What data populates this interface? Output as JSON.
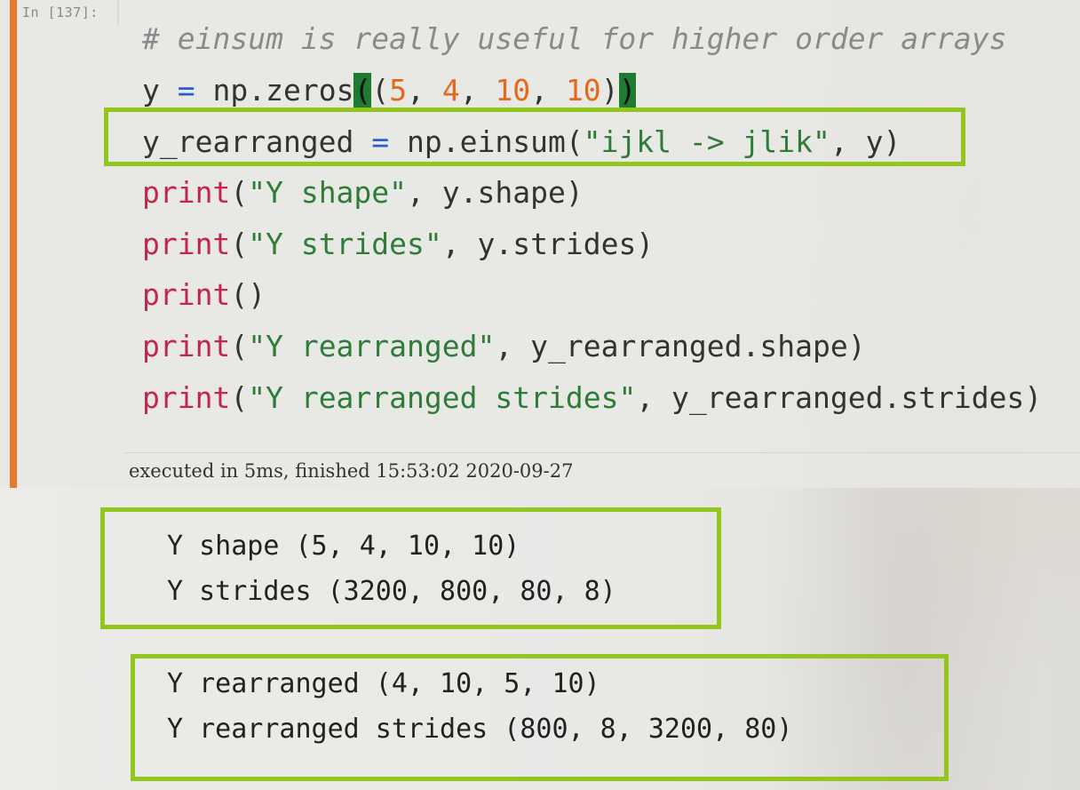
{
  "cell": {
    "prompt": "In [137]:",
    "code_lines": [
      {
        "segments": [
          {
            "cls": "cm",
            "text": "# einsum is really useful for higher order arrays"
          }
        ]
      },
      {
        "segments": [
          {
            "cls": "",
            "text": "y "
          },
          {
            "cls": "op",
            "text": "="
          },
          {
            "cls": "",
            "text": " np.zeros"
          },
          {
            "cls": "bracket-hl",
            "text": "("
          },
          {
            "cls": "",
            "text": "("
          },
          {
            "cls": "nm",
            "text": "5"
          },
          {
            "cls": "",
            "text": ", "
          },
          {
            "cls": "nm",
            "text": "4"
          },
          {
            "cls": "",
            "text": ", "
          },
          {
            "cls": "nm",
            "text": "10"
          },
          {
            "cls": "",
            "text": ", "
          },
          {
            "cls": "nm",
            "text": "10"
          },
          {
            "cls": "",
            "text": ")"
          },
          {
            "cls": "bracket-hl",
            "text": ")"
          }
        ]
      },
      {
        "segments": [
          {
            "cls": "",
            "text": "y_rearranged "
          },
          {
            "cls": "op",
            "text": "="
          },
          {
            "cls": "",
            "text": " np.einsum("
          },
          {
            "cls": "st",
            "text": "\"ijkl -> jlik\""
          },
          {
            "cls": "",
            "text": ", y)"
          }
        ]
      },
      {
        "segments": [
          {
            "cls": "kw",
            "text": "print"
          },
          {
            "cls": "",
            "text": "("
          },
          {
            "cls": "st",
            "text": "\"Y shape\""
          },
          {
            "cls": "",
            "text": ", y.shape)"
          }
        ]
      },
      {
        "segments": [
          {
            "cls": "kw",
            "text": "print"
          },
          {
            "cls": "",
            "text": "("
          },
          {
            "cls": "st",
            "text": "\"Y strides\""
          },
          {
            "cls": "",
            "text": ", y.strides)"
          }
        ]
      },
      {
        "segments": [
          {
            "cls": "kw",
            "text": "print"
          },
          {
            "cls": "",
            "text": "()"
          }
        ]
      },
      {
        "segments": [
          {
            "cls": "kw",
            "text": "print"
          },
          {
            "cls": "",
            "text": "("
          },
          {
            "cls": "st",
            "text": "\"Y rearranged\""
          },
          {
            "cls": "",
            "text": ", y_rearranged.shape)"
          }
        ]
      },
      {
        "segments": [
          {
            "cls": "kw",
            "text": "print"
          },
          {
            "cls": "",
            "text": "("
          },
          {
            "cls": "st",
            "text": "\"Y rearranged strides\""
          },
          {
            "cls": "",
            "text": ", y_rearranged.strides)"
          }
        ]
      }
    ],
    "executed_text": "executed in 5ms, finished 15:53:02 2020-09-27"
  },
  "output": {
    "lines": [
      "Y shape (5, 4, 10, 10)",
      "Y strides (3200, 800, 80, 8)",
      "Y rearranged (4, 10, 5, 10)",
      "Y rearranged strides (800, 8, 3200, 80)"
    ]
  },
  "colors": {
    "cell_bar": "#e8782a",
    "highlight_box": "#92c61f",
    "keyword": "#c2264a",
    "string": "#2f7c38",
    "number": "#e2691e",
    "operator": "#2b5cd1",
    "comment": "#8a8a8a"
  }
}
